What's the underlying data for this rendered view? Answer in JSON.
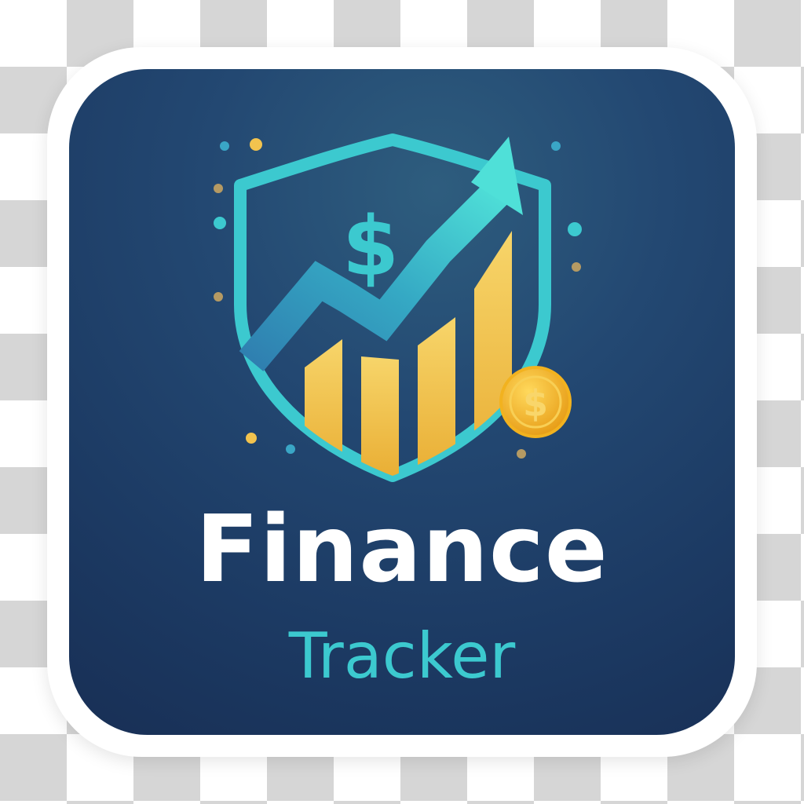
{
  "app_icon": {
    "title": "Finance",
    "subtitle": "Tracker",
    "logo": {
      "shield_glyph": "$",
      "coin_glyph": "$",
      "icon_name": "finance-shield-growth-icon"
    },
    "colors": {
      "tile_background": "#1f3d66",
      "title_text": "#ffffff",
      "subtitle_text": "#3cc9cf",
      "shield_teal": "#3cc9cf",
      "bars_gold": "#f2c34e",
      "coin_gold": "#f5b72a",
      "checkerboard_light": "#ffffff",
      "checkerboard_dark": "#d6d6d6"
    }
  }
}
